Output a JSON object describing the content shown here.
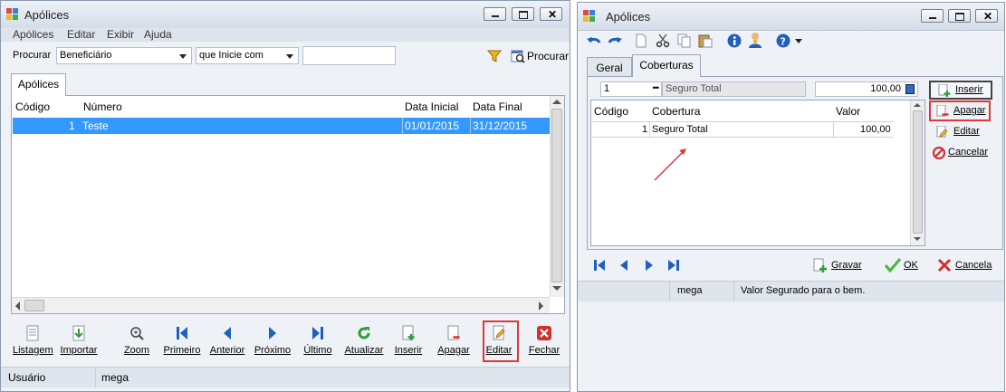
{
  "left_window": {
    "title": "Apólices",
    "menu": [
      "Apólices",
      "Editar",
      "Exibir",
      "Ajuda"
    ],
    "search": {
      "label": "Procurar",
      "field_value": "Beneficiário",
      "operator_value": "que Inicie com",
      "text_value": "",
      "search_button": "Procurar"
    },
    "tab": "Apólices",
    "table": {
      "columns": [
        "Código",
        "Número",
        "Data Inicial",
        "Data Final"
      ],
      "rows": [
        {
          "codigo": "1",
          "numero": "Teste",
          "data_inicial": "01/01/2015",
          "data_final": "31/12/2015"
        }
      ]
    },
    "toolbar": [
      "Listagem",
      "Importar",
      "Zoom",
      "Primeiro",
      "Anterior",
      "Próximo",
      "Último",
      "Atualizar",
      "Inserir",
      "Apagar",
      "Editar",
      "Fechar"
    ],
    "status": {
      "label": "Usuário",
      "value": "mega"
    }
  },
  "right_window": {
    "title": "Apólices",
    "tabs": [
      "Geral",
      "Coberturas"
    ],
    "edit_row": {
      "codigo": "1",
      "ellipsis": "•••",
      "descricao": "Seguro Total",
      "valor": "100,00"
    },
    "table": {
      "columns": [
        "Código",
        "Cobertura",
        "Valor"
      ],
      "rows": [
        {
          "codigo": "1",
          "cobertura": "Seguro Total",
          "valor": "100,00"
        }
      ]
    },
    "side_buttons": [
      "Inserir",
      "Apagar",
      "Editar",
      "Cancelar"
    ],
    "footer_buttons": [
      "Gravar",
      "OK",
      "Cancela"
    ],
    "status": {
      "user": "mega",
      "hint": "Valor Segurado para o bem."
    }
  },
  "colors": {
    "selection": "#3399ff",
    "highlight": "#e03838",
    "accent_blue": "#1f5fbf"
  }
}
